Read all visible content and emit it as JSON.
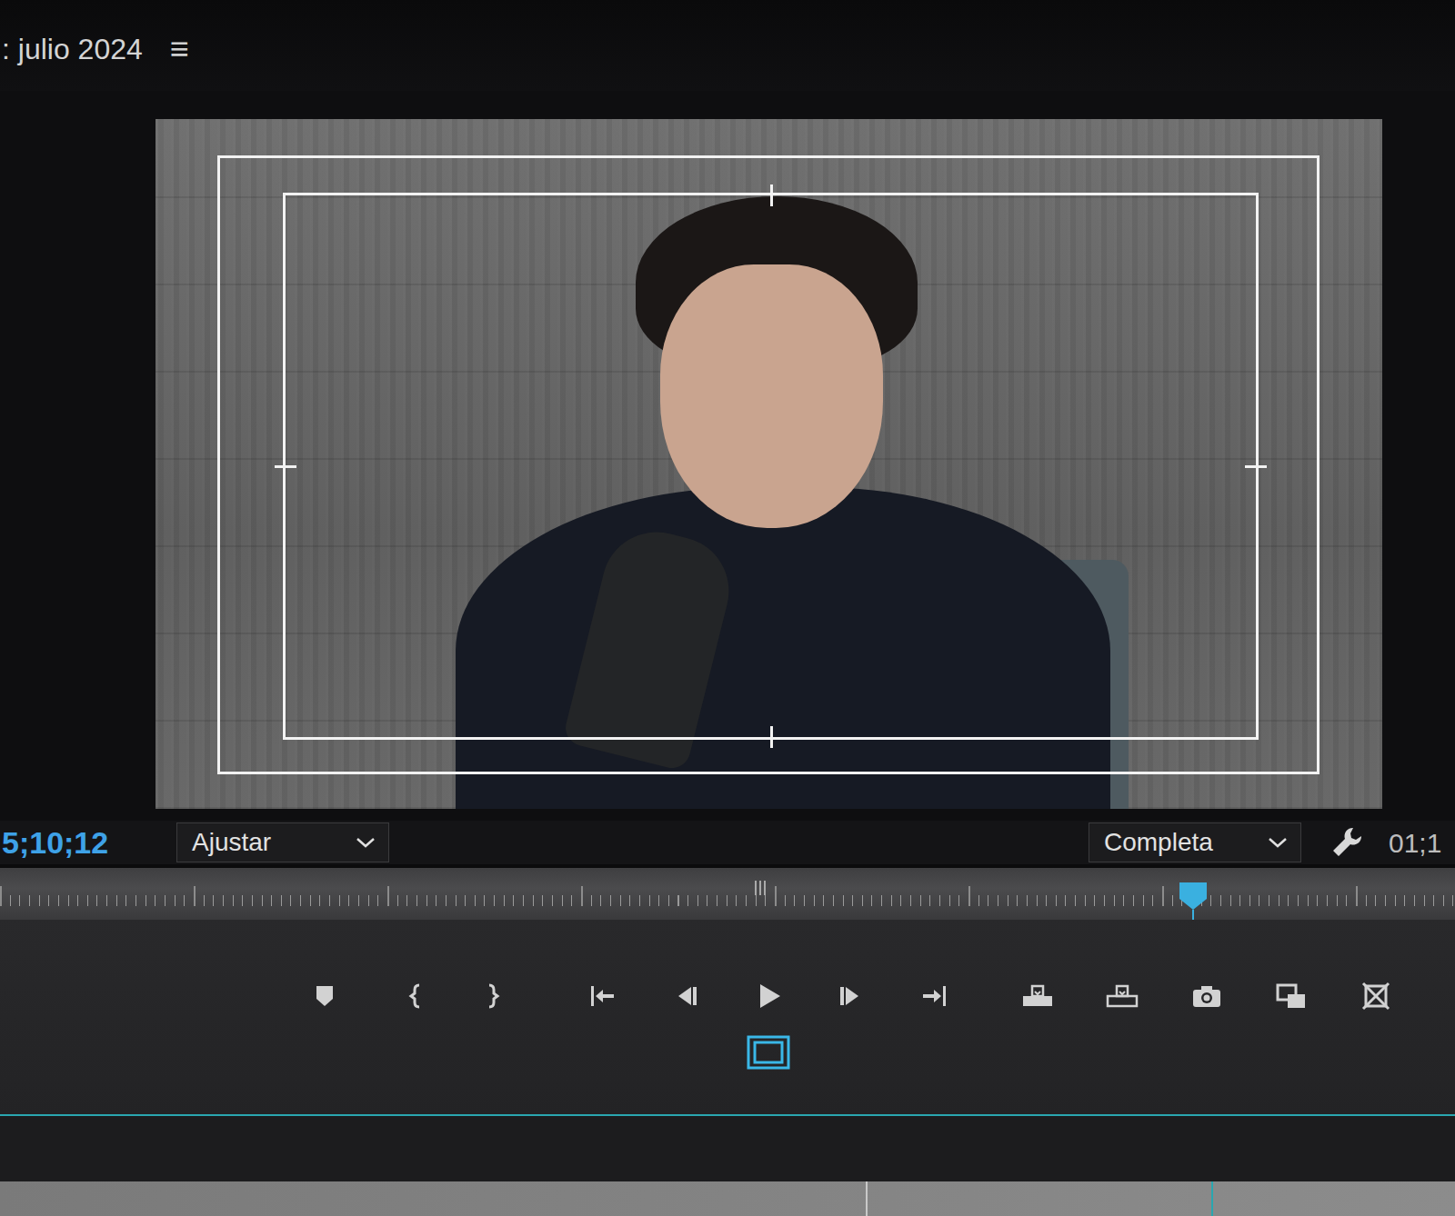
{
  "panel": {
    "title": ": julio 2024",
    "menu": "≡"
  },
  "monitor": {
    "safe_margins_on": true
  },
  "toolbar": {
    "timecode": "5;10;12",
    "zoom": "Ajustar",
    "resolution": "Completa",
    "duration": "01;1"
  },
  "ruler": {
    "playhead_level": 0.82
  }
}
